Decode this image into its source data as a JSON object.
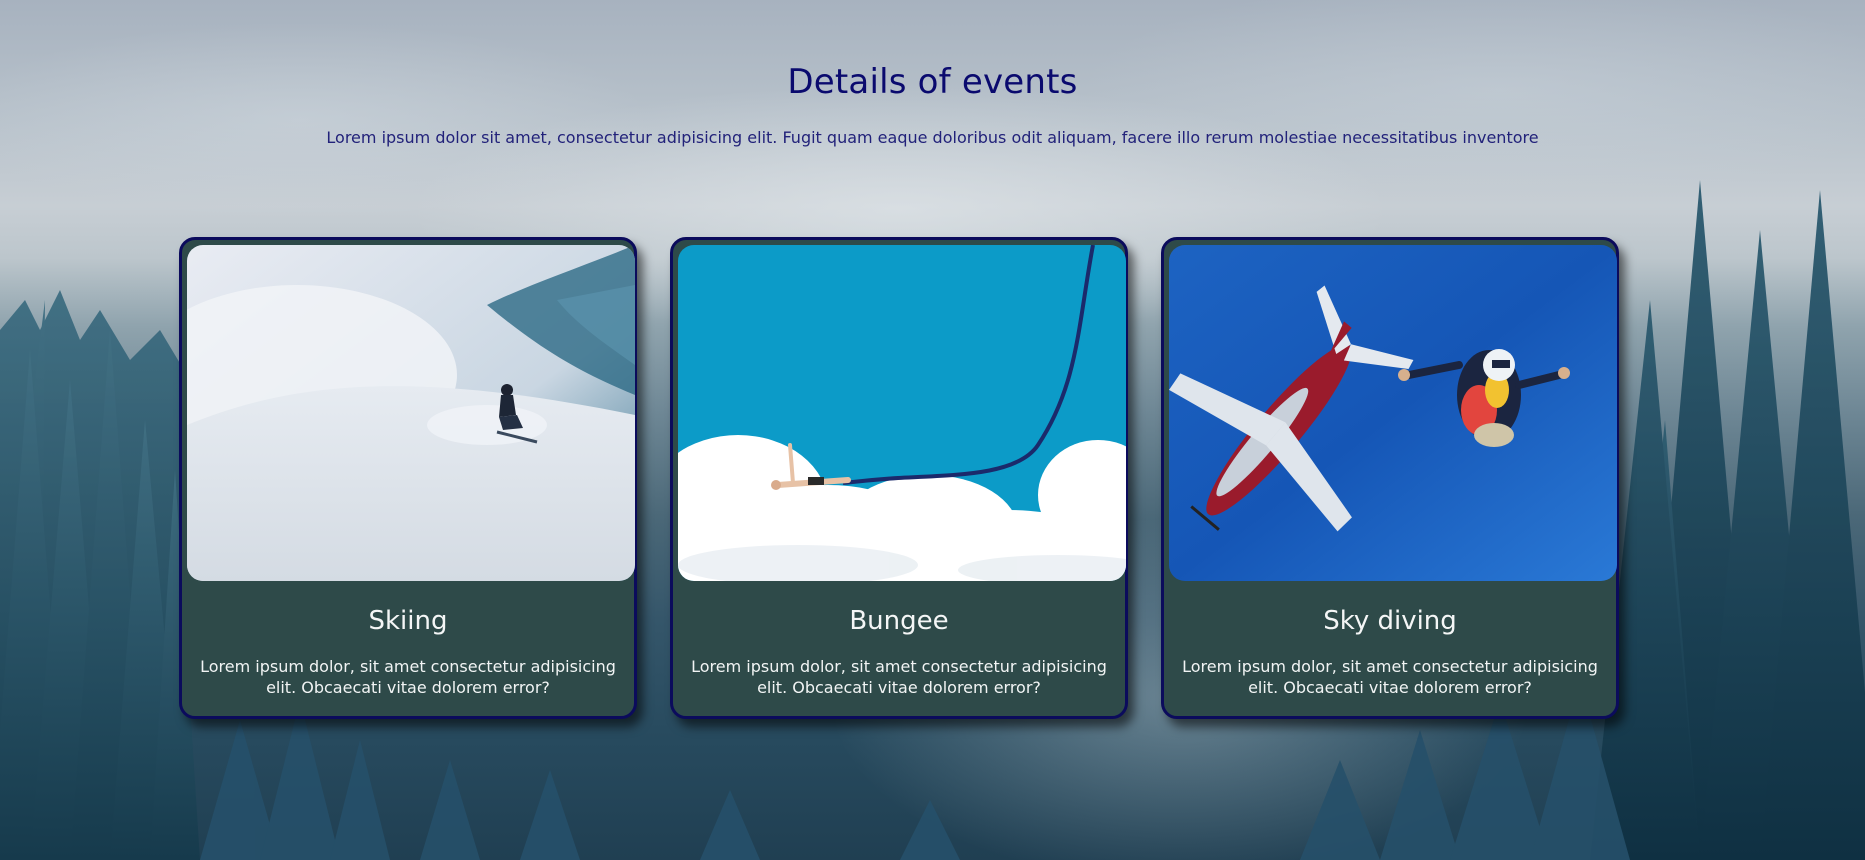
{
  "section": {
    "title": "Details of events",
    "subtitle": "Lorem ipsum dolor sit amet, consectetur adipisicing elit. Fugit quam eaque doloribus odit aliquam, facere illo rerum molestiae necessitatibus inventore"
  },
  "cards": [
    {
      "title": "Skiing",
      "text": "Lorem ipsum dolor, sit amet consectetur adipisicing elit. Obcaecati vitae dolorem error?",
      "image": "skier-in-powder-snow"
    },
    {
      "title": "Bungee",
      "text": "Lorem ipsum dolor, sit amet consectetur adipisicing elit. Obcaecati vitae dolorem error?",
      "image": "bungee-jumper-over-clouds"
    },
    {
      "title": "Sky diving",
      "text": "Lorem ipsum dolor, sit amet consectetur adipisicing elit. Obcaecati vitae dolorem error?",
      "image": "skydiver-and-airplane"
    }
  ],
  "colors": {
    "title": "#0a0a6e",
    "card_background": "#2e4a49",
    "card_border": "#0b0b5c"
  }
}
